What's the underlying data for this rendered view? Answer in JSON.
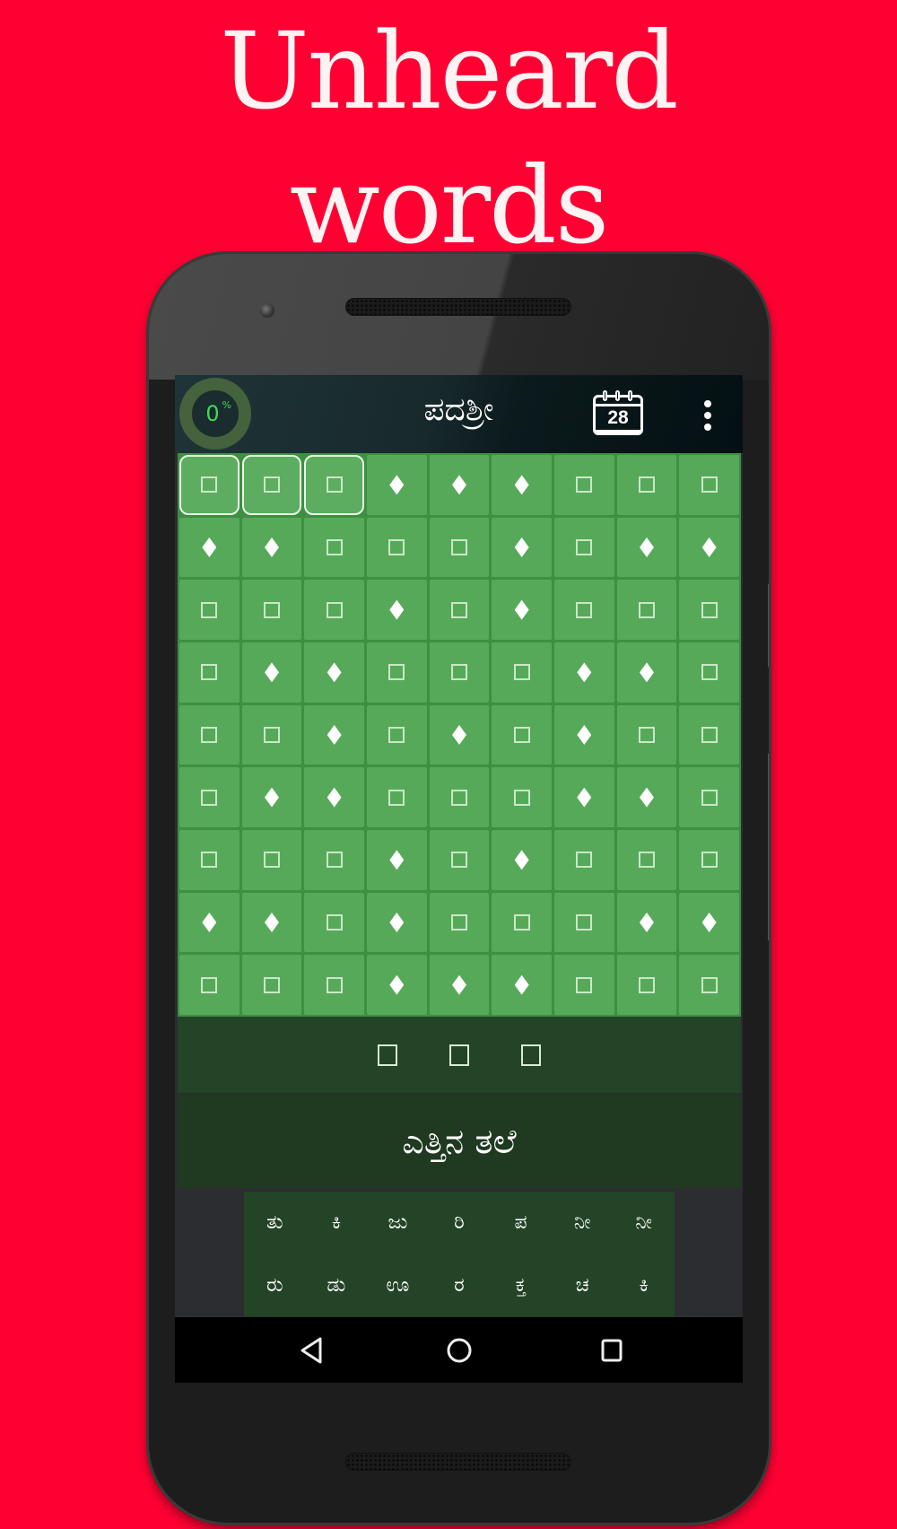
{
  "banner": {
    "line1": "Unheard",
    "line2": "words"
  },
  "app": {
    "title": "ಪದಶ್ರೀ",
    "progress": {
      "value": "0",
      "unit": "%",
      "percent": 0
    },
    "calendar_day": "28",
    "menu_icon": "more-vert-icon"
  },
  "grid": {
    "rows": 9,
    "cols": 9,
    "selected_cells": [
      [
        0,
        0
      ],
      [
        0,
        1
      ],
      [
        0,
        2
      ]
    ],
    "cells": [
      [
        "box",
        "box",
        "box",
        "diamond",
        "diamond",
        "diamond",
        "box",
        "box",
        "box"
      ],
      [
        "diamond",
        "diamond",
        "box",
        "box",
        "box",
        "diamond",
        "box",
        "diamond",
        "diamond"
      ],
      [
        "box",
        "box",
        "box",
        "diamond",
        "box",
        "diamond",
        "box",
        "box",
        "box"
      ],
      [
        "box",
        "diamond",
        "diamond",
        "box",
        "box",
        "box",
        "diamond",
        "diamond",
        "box"
      ],
      [
        "box",
        "box",
        "diamond",
        "box",
        "diamond",
        "box",
        "diamond",
        "box",
        "box"
      ],
      [
        "box",
        "diamond",
        "diamond",
        "box",
        "box",
        "box",
        "diamond",
        "diamond",
        "box"
      ],
      [
        "box",
        "box",
        "box",
        "diamond",
        "box",
        "diamond",
        "box",
        "box",
        "box"
      ],
      [
        "diamond",
        "diamond",
        "box",
        "diamond",
        "box",
        "box",
        "box",
        "diamond",
        "diamond"
      ],
      [
        "box",
        "box",
        "box",
        "diamond",
        "diamond",
        "diamond",
        "box",
        "box",
        "box"
      ]
    ]
  },
  "answer": {
    "slots": 3,
    "letters": [
      "",
      "",
      ""
    ]
  },
  "hint": {
    "text": "ಎತ್ತಿನ ತಲೆ"
  },
  "keyboard": {
    "rows": [
      [
        "ತು",
        "ಕಿ",
        "ಜು",
        "ರಿ",
        "ಪ",
        "ನೀ",
        "ನೀ"
      ],
      [
        "ರು",
        "ಡು",
        "ಊ",
        "ರ",
        "ಕ್ತ",
        "ಚ",
        "ಕಿ"
      ]
    ]
  },
  "navbar": {
    "back": "back-icon",
    "home": "home-icon",
    "recents": "recents-icon"
  },
  "colors": {
    "background": "#ff0033",
    "cell": "#57a95a",
    "panel": "#234426",
    "progress": "#3ddc56"
  }
}
